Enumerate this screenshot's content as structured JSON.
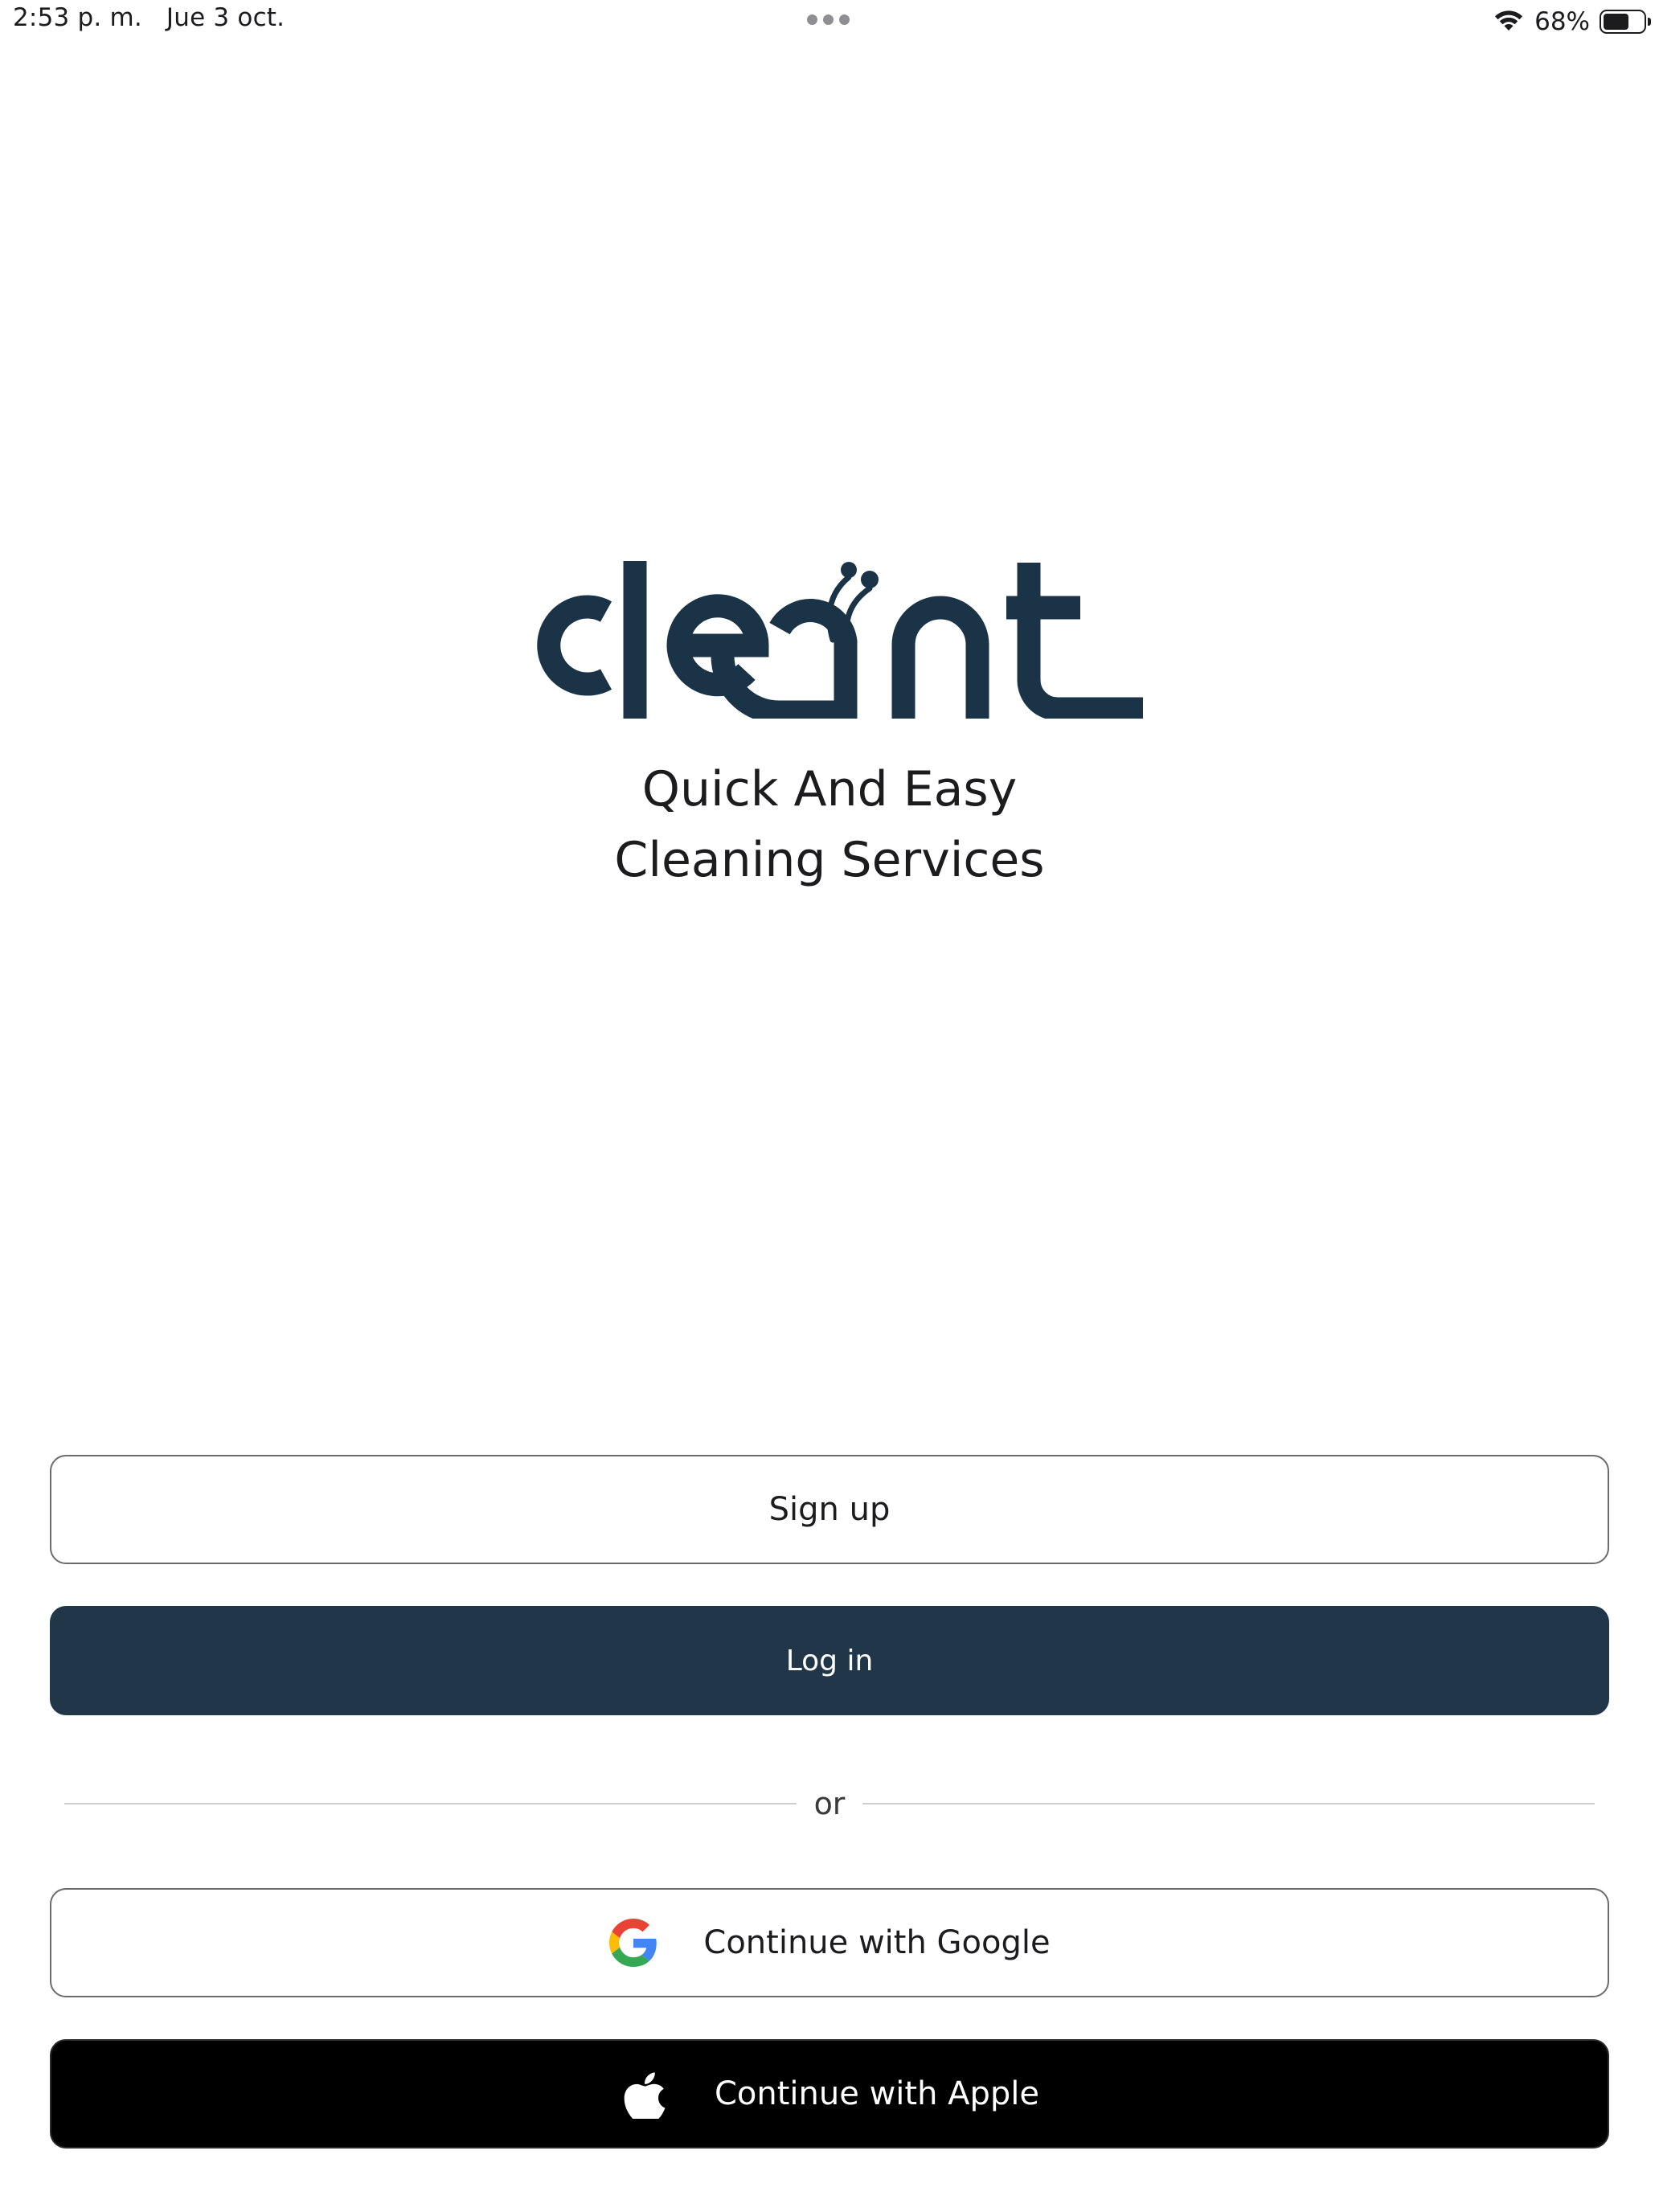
{
  "status_bar": {
    "time": "2:53 p. m.",
    "date": "Jue 3 oct.",
    "battery_percent": "68%",
    "battery_level": 0.68,
    "icons": [
      "wifi-icon",
      "battery-icon",
      "multitasking-dots-icon"
    ]
  },
  "brand": {
    "logo_text": "cleant",
    "logo_color": "#1B3347",
    "tagline_line1": "Quick And Easy",
    "tagline_line2": "Cleaning Services"
  },
  "actions": {
    "signup_label": "Sign up",
    "login_label": "Log in",
    "divider_text": "or",
    "google_label": "Continue with Google",
    "apple_label": "Continue with Apple"
  },
  "colors": {
    "login_bg": "#213749",
    "apple_bg": "#000000",
    "outline_border": "#6B6B6B",
    "google_blue": "#4285F4",
    "google_red": "#EA4335",
    "google_yellow": "#FBBC05",
    "google_green": "#34A853"
  }
}
